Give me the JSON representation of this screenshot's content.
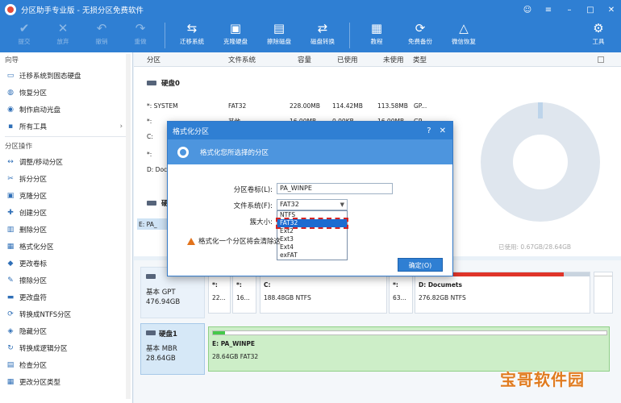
{
  "window": {
    "title": "分区助手专业版 - 无损分区免费软件",
    "controls": [
      "☺",
      "≡",
      "–",
      "□",
      "✕"
    ]
  },
  "toolbar": [
    {
      "label": "提交",
      "icon": "check-icon",
      "glyph": "✔",
      "enabled": false
    },
    {
      "label": "放弃",
      "icon": "cancel-icon",
      "glyph": "✕",
      "enabled": false
    },
    {
      "label": "撤销",
      "icon": "undo-icon",
      "glyph": "↶",
      "enabled": false
    },
    {
      "label": "重做",
      "icon": "redo-icon",
      "glyph": "↷",
      "enabled": false
    },
    {
      "label": "迁移系统",
      "icon": "migrate-icon",
      "glyph": "⇆",
      "enabled": true
    },
    {
      "label": "克隆硬盘",
      "icon": "clone-icon",
      "glyph": "▣",
      "enabled": true
    },
    {
      "label": "擦除磁盘",
      "icon": "wipe-icon",
      "glyph": "▤",
      "enabled": true
    },
    {
      "label": "磁盘转换",
      "icon": "convert-icon",
      "glyph": "⇄",
      "enabled": true
    },
    {
      "label": "教程",
      "icon": "tutorial-icon",
      "glyph": "▦",
      "enabled": true
    },
    {
      "label": "免费备份",
      "icon": "backup-icon",
      "glyph": "⟳",
      "enabled": true
    },
    {
      "label": "微信恢复",
      "icon": "recover-icon",
      "glyph": "△",
      "enabled": true
    },
    {
      "label": "工具",
      "icon": "tools-icon",
      "glyph": "⚙",
      "enabled": true
    }
  ],
  "sidebar": {
    "wizard_title": "向导",
    "wizard_items": [
      {
        "label": "迁移系统到固态硬盘",
        "icon": "migrate-ssd-icon",
        "glyph": "▭"
      },
      {
        "label": "恢复分区",
        "icon": "restore-icon",
        "glyph": "◍"
      },
      {
        "label": "制作启动光盘",
        "icon": "disc-icon",
        "glyph": "◉"
      },
      {
        "label": "所有工具",
        "icon": "tools-icon",
        "glyph": "▪",
        "chevron": "›"
      }
    ],
    "ops_title": "分区操作",
    "ops_items": [
      {
        "label": "调整/移动分区",
        "icon": "resize-icon",
        "glyph": "↔"
      },
      {
        "label": "拆分分区",
        "icon": "split-icon",
        "glyph": "✂"
      },
      {
        "label": "克隆分区",
        "icon": "clone-icon",
        "glyph": "▣"
      },
      {
        "label": "创建分区",
        "icon": "create-icon",
        "glyph": "✚"
      },
      {
        "label": "删除分区",
        "icon": "delete-icon",
        "glyph": "▥"
      },
      {
        "label": "格式化分区",
        "icon": "format-icon",
        "glyph": "▦"
      },
      {
        "label": "更改卷标",
        "icon": "label-icon",
        "glyph": "◆"
      },
      {
        "label": "擦除分区",
        "icon": "erase-icon",
        "glyph": "✎"
      },
      {
        "label": "更改盘符",
        "icon": "letter-icon",
        "glyph": "▬"
      },
      {
        "label": "转换成NTFS分区",
        "icon": "ntfs-icon",
        "glyph": "⟳"
      },
      {
        "label": "隐藏分区",
        "icon": "hide-icon",
        "glyph": "◈"
      },
      {
        "label": "转换成逻辑分区",
        "icon": "logical-icon",
        "glyph": "↻"
      },
      {
        "label": "检查分区",
        "icon": "check-icon",
        "glyph": "▤"
      },
      {
        "label": "更改分区类型",
        "icon": "type-icon",
        "glyph": "▦"
      }
    ]
  },
  "table": {
    "columns": [
      "分区",
      "文件系统",
      "容量",
      "已使用",
      "未使用",
      "类型"
    ],
    "disk0_label": "硬盘0",
    "rows": [
      {
        "name": "*: SYSTEM",
        "fs": "FAT32",
        "cap": "228.00MB",
        "used": "114.42MB",
        "free": "113.58MB",
        "type": "GP..."
      },
      {
        "name": "*:",
        "fs": "其他",
        "cap": "16.00MB",
        "used": "0.00KB",
        "free": "16.00MB",
        "type": "GP..."
      },
      {
        "name": "C:",
        "fs": "",
        "cap": "",
        "used": "",
        "free": "",
        "type": ""
      },
      {
        "name": "*:",
        "fs": "",
        "cap": "",
        "used": "",
        "free": "",
        "type": ""
      },
      {
        "name": "D: Docu",
        "fs": "",
        "cap": "",
        "used": "",
        "free": "",
        "type": ""
      }
    ],
    "disk1_label": "硬",
    "disk1_rows": [
      {
        "name": "E: PA_"
      }
    ]
  },
  "usage": {
    "used_label": "已使用: 0.67GB/28.64GB"
  },
  "disk_map": {
    "disk0": {
      "title": "",
      "type": "基本 GPT",
      "size": "476.94GB"
    },
    "disk0_parts": [
      {
        "name": "*:",
        "info": "22..."
      },
      {
        "name": "*:",
        "info": "16..."
      },
      {
        "name": "C:",
        "info": "188.48GB NTFS"
      },
      {
        "name": "*:",
        "info": "63..."
      },
      {
        "name": "D: Documets",
        "info": "276.82GB NTFS"
      }
    ],
    "disk1": {
      "title": "硬盘1",
      "type": "基本 MBR",
      "size": "28.64GB"
    },
    "disk1_parts": [
      {
        "name": "E: PA_WINPE",
        "info": "28.64GB FAT32"
      }
    ],
    "disk1_used_fraction": 0.03,
    "disk0_c_used_fraction": 0.6,
    "disk0_d_used_fraction": 0.85
  },
  "dialog": {
    "title": "格式化分区",
    "controls": [
      "?",
      "✕"
    ],
    "header": "格式化您所选择的分区",
    "volume_label": "分区卷标(L):",
    "volume_value": "PA_WINPE",
    "fs_label": "文件系统(F):",
    "fs_value": "FAT32",
    "cluster_label": "簇大小:",
    "fs_options": [
      "NTFS",
      "FAT32",
      "Ext2",
      "Ext3",
      "Ext4",
      "exFAT"
    ],
    "selected_option": "FAT32",
    "warning": "格式化一个分区将会清除这",
    "ok": "确定(O)"
  },
  "watermark": "宝哥软件园"
}
